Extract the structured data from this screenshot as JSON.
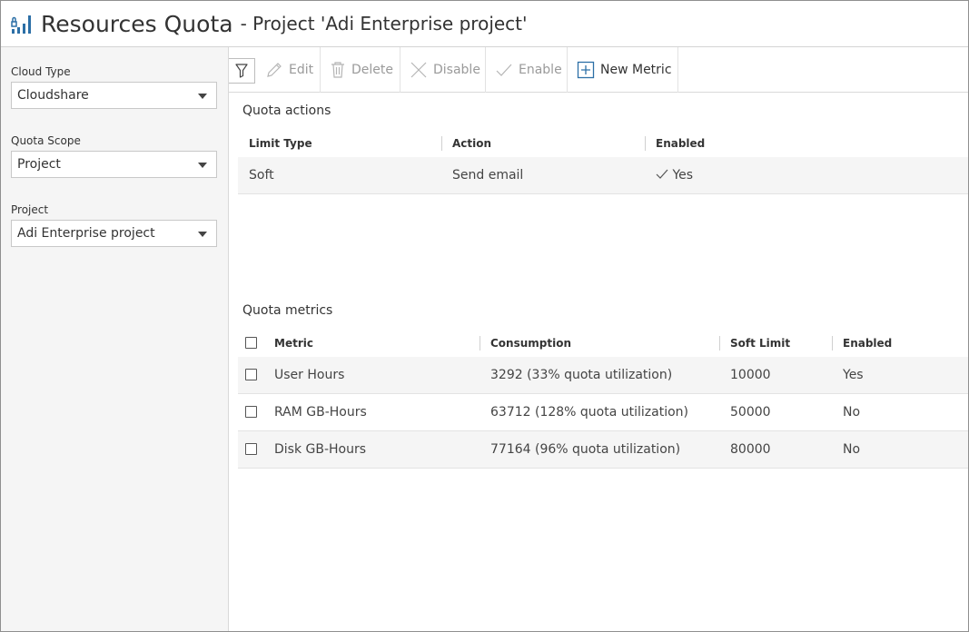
{
  "header": {
    "title": "Resources Quota",
    "subtitle": "- Project 'Adi Enterprise project'"
  },
  "sidebar": {
    "cloud_type": {
      "label": "Cloud Type",
      "value": "Cloudshare"
    },
    "quota_scope": {
      "label": "Quota Scope",
      "value": "Project"
    },
    "project": {
      "label": "Project",
      "value": "Adi Enterprise project"
    }
  },
  "toolbar": {
    "edit": "Edit",
    "delete": "Delete",
    "disable": "Disable",
    "enable": "Enable",
    "new_metric": "New Metric"
  },
  "quota_actions": {
    "title": "Quota actions",
    "columns": [
      "Limit Type",
      "Action",
      "Enabled"
    ],
    "rows": [
      {
        "limit_type": "Soft",
        "action": "Send email",
        "enabled": "Yes"
      }
    ]
  },
  "quota_metrics": {
    "title": "Quota metrics",
    "columns": [
      "Metric",
      "Consumption",
      "Soft Limit",
      "Enabled"
    ],
    "rows": [
      {
        "metric": "User Hours",
        "consumption": "3292 (33% quota utilization)",
        "soft_limit": "10000",
        "enabled": "Yes"
      },
      {
        "metric": "RAM GB-Hours",
        "consumption": "63712 (128% quota utilization)",
        "soft_limit": "50000",
        "enabled": "No"
      },
      {
        "metric": "Disk GB-Hours",
        "consumption": "77164 (96% quota utilization)",
        "soft_limit": "80000",
        "enabled": "No"
      }
    ]
  },
  "colors": {
    "accent": "#2c6fa6",
    "disabled_text": "#9a9a9a"
  }
}
